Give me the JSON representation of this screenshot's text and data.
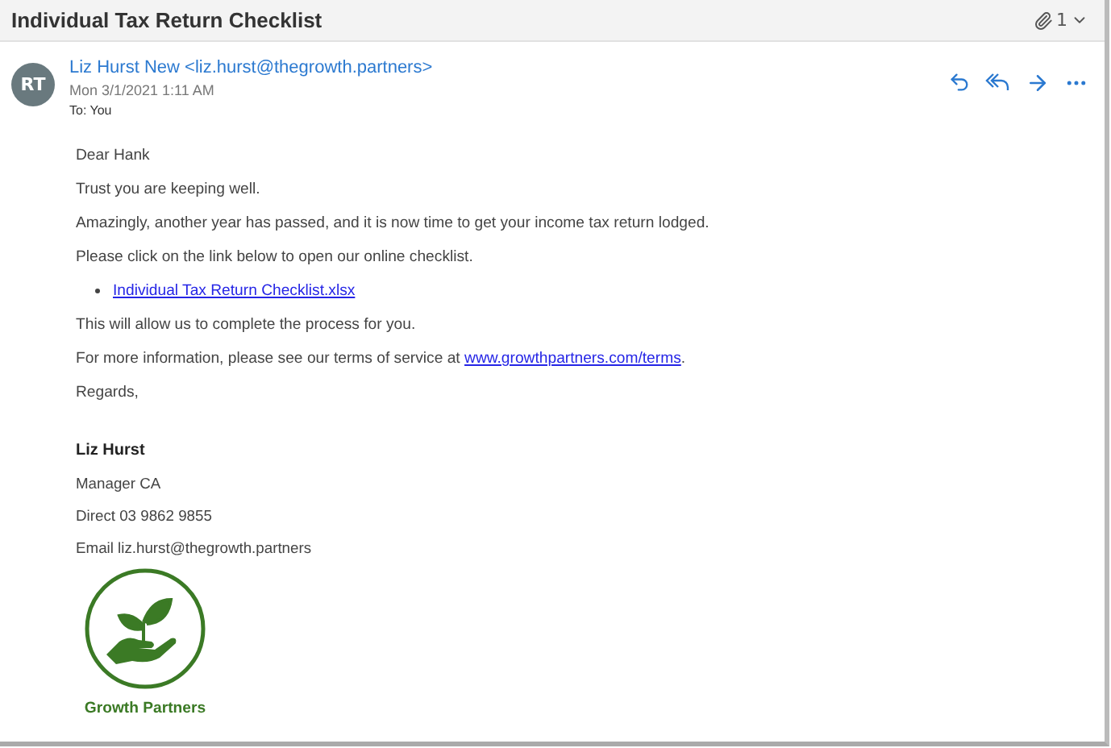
{
  "subject": "Individual Tax Return Checklist",
  "attachments": {
    "count": "1"
  },
  "message": {
    "avatar": "RT",
    "sender": "Liz Hurst New <liz.hurst@thegrowth.partners>",
    "date": "Mon 3/1/2021 1:11 AM",
    "to_label": "To:",
    "to": "You"
  },
  "body": [
    {
      "kind": "text",
      "text": "Dear Hank"
    },
    {
      "kind": "text",
      "text": "Trust you are keeping well."
    },
    {
      "kind": "text",
      "text": "Amazingly, another year has passed, and it is now time to get your income tax return lodged."
    },
    {
      "kind": "text",
      "text": "Please click on the link below to open our online checklist."
    },
    {
      "kind": "bullet_link",
      "link": "Individual Tax Return Checklist.xlsx"
    },
    {
      "kind": "text",
      "text": "This will allow us to complete the process for you."
    },
    {
      "kind": "text_link",
      "before": "For more information, please see our terms of service at ",
      "link": "www.growthpartners.com/terms",
      "after": "."
    },
    {
      "kind": "text",
      "text": "Regards,"
    }
  ],
  "signature": {
    "name": "Liz Hurst",
    "lines": [
      "Manager CA",
      "Direct 03 9862 9855",
      "Email liz.hurst@thegrowth.partners"
    ],
    "logo_caption": "Growth Partners"
  }
}
